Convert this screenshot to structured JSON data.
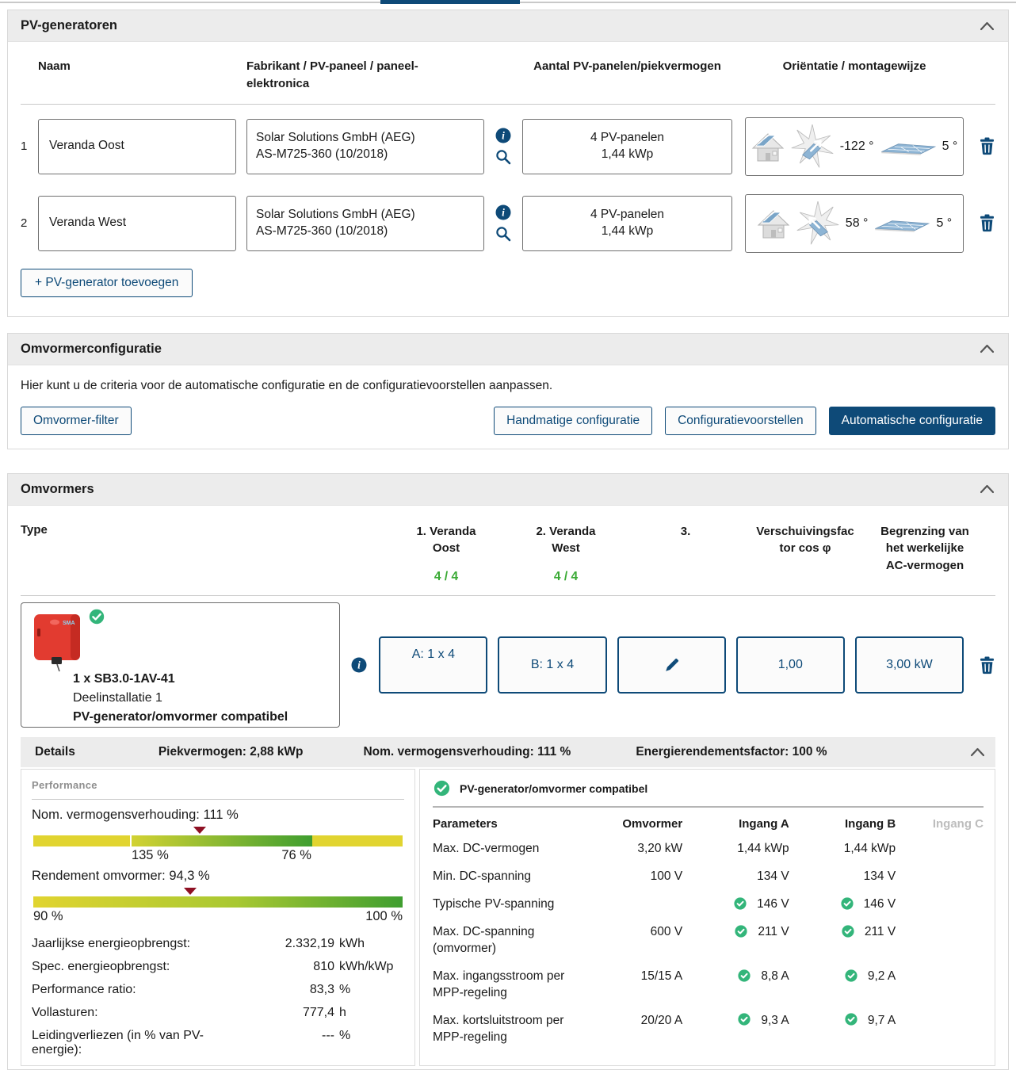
{
  "colors": {
    "accent": "#0e4a78",
    "green_check": "#33b57a",
    "green_text": "#3aaa35",
    "marker_red": "#8e1023",
    "gauge_yellow": "#e1d430",
    "gauge_green": "#3f9e30"
  },
  "pv_generators": {
    "title": "PV-generatoren",
    "col_naam": "Naam",
    "col_fabrikant": "Fabrikant / PV-paneel / paneel-elektronica",
    "col_aantal": "Aantal PV-panelen/piekvermogen",
    "col_orientatie": "Oriëntatie / montagewijze",
    "rows": [
      {
        "num": "1",
        "name": "Veranda Oost",
        "manufacturer": "Solar Solutions GmbH (AEG)",
        "module": "AS-M725-360 (10/2018)",
        "panels": "4 PV-panelen",
        "peak": "1,44 kWp",
        "azimuth": "-122 °",
        "tilt": "5 °"
      },
      {
        "num": "2",
        "name": "Veranda West",
        "manufacturer": "Solar Solutions GmbH (AEG)",
        "module": "AS-M725-360 (10/2018)",
        "panels": "4 PV-panelen",
        "peak": "1,44 kWp",
        "azimuth": "58 °",
        "tilt": "5 °"
      }
    ],
    "add_button": "+ PV-generator toevoegen"
  },
  "omvormerconfiguratie": {
    "title": "Omvormerconfiguratie",
    "description": "Hier kunt u de criteria voor de automatische configuratie en de configuratievoorstellen aanpassen.",
    "filter_button": "Omvormer-filter",
    "manual_button": "Handmatige configuratie",
    "proposals_button": "Configuratievoorstellen",
    "auto_button": "Automatische configuratie"
  },
  "omvormers": {
    "title": "Omvormers",
    "col_type": "Type",
    "col1": "1. Veranda Oost",
    "col1_sub": "4 / 4",
    "col2": "2. Veranda West",
    "col2_sub": "4 / 4",
    "col3": "3.",
    "col4": "Verschuivingsfactor cos φ",
    "col5": "Begrenzing van het werkelijke AC-vermogen",
    "row": {
      "title": "1 x SB3.0-1AV-41",
      "subtitle": "Deelinstallatie 1",
      "status": "PV-generator/omvormer compatibel",
      "input_a": "A: 1 x 4",
      "input_b": "B: 1 x 4",
      "cos_phi": "1,00",
      "ac_limit": "3,00 kW"
    }
  },
  "details_bar": {
    "label": "Details",
    "piekvermogen": "Piekvermogen: 2,88 kWp",
    "nom": "Nom. vermogensverhouding: 111 %",
    "energie": "Energierendementsfactor: 100 %"
  },
  "performance": {
    "title": "Performance",
    "gauge1_label": "Nom. vermogensverhouding: 111 %",
    "gauge1_left": "135 %",
    "gauge1_right": "76 %",
    "gauge1_marker_pct": 45,
    "gauge2_label": "Rendement omvormer: 94,3 %",
    "gauge2_left": "90 %",
    "gauge2_right": "100 %",
    "gauge2_marker_pct": 42.5,
    "kv": [
      {
        "label": "Jaarlijkse energieopbrengst:",
        "value": "2.332,19",
        "unit": "kWh"
      },
      {
        "label": "Spec. energieopbrengst:",
        "value": "810",
        "unit": "kWh/kWp"
      },
      {
        "label": "Performance ratio:",
        "value": "83,3",
        "unit": "%"
      },
      {
        "label": "Vollasturen:",
        "value": "777,4",
        "unit": "h"
      },
      {
        "label": "Leidingverliezen (in % van PV-energie):",
        "value": "---",
        "unit": "%"
      }
    ]
  },
  "compat": {
    "status": "PV-generator/omvormer compatibel",
    "h_param": "Parameters",
    "h_omv": "Omvormer",
    "h_a": "Ingang A",
    "h_b": "Ingang B",
    "h_c": "Ingang C",
    "rows": [
      {
        "label": "Max. DC-vermogen",
        "omv": "3,20 kW",
        "a": "1,44 kWp",
        "b": "1,44 kWp"
      },
      {
        "label": "Min. DC-spanning",
        "omv": "100 V",
        "a": "134 V",
        "b": "134 V"
      },
      {
        "label": "Typische PV-spanning",
        "omv": "",
        "a": "146 V",
        "b": "146 V"
      },
      {
        "label": "Max. DC-spanning (omvormer)",
        "omv": "600 V",
        "a": "211 V",
        "b": "211 V"
      },
      {
        "label": "Max. ingangsstroom per MPP-regeling",
        "omv": "15/15 A",
        "a": "8,8 A",
        "b": "9,2 A"
      },
      {
        "label": "Max. kortsluitstroom per MPP-regeling",
        "omv": "20/20 A",
        "a": "9,3 A",
        "b": "9,7 A"
      }
    ]
  }
}
